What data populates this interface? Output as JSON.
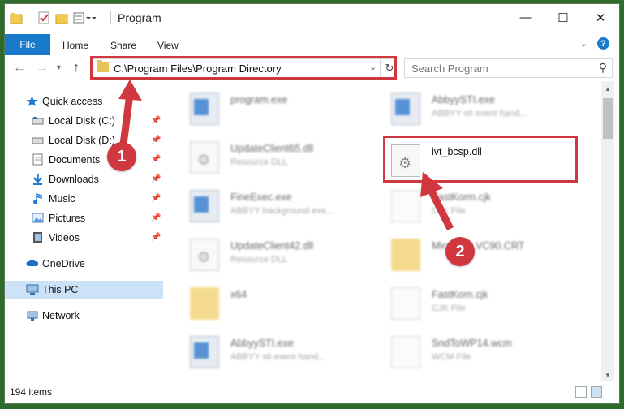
{
  "window": {
    "title": "Program"
  },
  "window_controls": {
    "minimize": "—",
    "maximize": "☐",
    "close": "✕"
  },
  "ribbon": {
    "tabs": [
      "File",
      "Home",
      "Share",
      "View"
    ],
    "help_glyph": "?"
  },
  "nav": {
    "address": "C:\\Program Files\\Program Directory",
    "search_placeholder": "Search Program"
  },
  "sidebar": {
    "quick_access": "Quick access",
    "items": [
      {
        "label": "Local Disk (C:)",
        "icon": "drive-icon"
      },
      {
        "label": "Local Disk (D:)",
        "icon": "drive-icon"
      },
      {
        "label": "Documents",
        "icon": "documents-icon"
      },
      {
        "label": "Downloads",
        "icon": "downloads-icon"
      },
      {
        "label": "Music",
        "icon": "music-icon"
      },
      {
        "label": "Pictures",
        "icon": "pictures-icon"
      },
      {
        "label": "Videos",
        "icon": "videos-icon"
      }
    ],
    "onedrive": "OneDrive",
    "this_pc": "This PC",
    "network": "Network"
  },
  "files": {
    "left": [
      {
        "name": "program.exe",
        "type": ""
      },
      {
        "name": "UpdateClient65.dll",
        "type": "Resource DLL"
      },
      {
        "name": "FineExec.exe",
        "type": "ABBYY background exe..."
      },
      {
        "name": "UpdateClient42.dll",
        "type": "Resource DLL"
      },
      {
        "name": "x64",
        "type": ""
      },
      {
        "name": "AbbyySTI.exe",
        "type": "ABBYY sti event hand..."
      }
    ],
    "right": [
      {
        "name": "AbbyySTI.exe",
        "type": "ABBYY sti event hand..."
      },
      {
        "name": "ivt_bcsp.dll",
        "type": ""
      },
      {
        "name": "FastKorm.cjk",
        "type": "CJK File"
      },
      {
        "name": "Microsoft.VC90.CRT",
        "type": ""
      },
      {
        "name": "FastKorn.cjk",
        "type": "CJK File"
      },
      {
        "name": "SndToWP14.wcm",
        "type": "WCM File"
      }
    ]
  },
  "status": {
    "count": "194 items"
  },
  "annotations": {
    "step1": "1",
    "step2": "2",
    "color": "#d0373f"
  }
}
